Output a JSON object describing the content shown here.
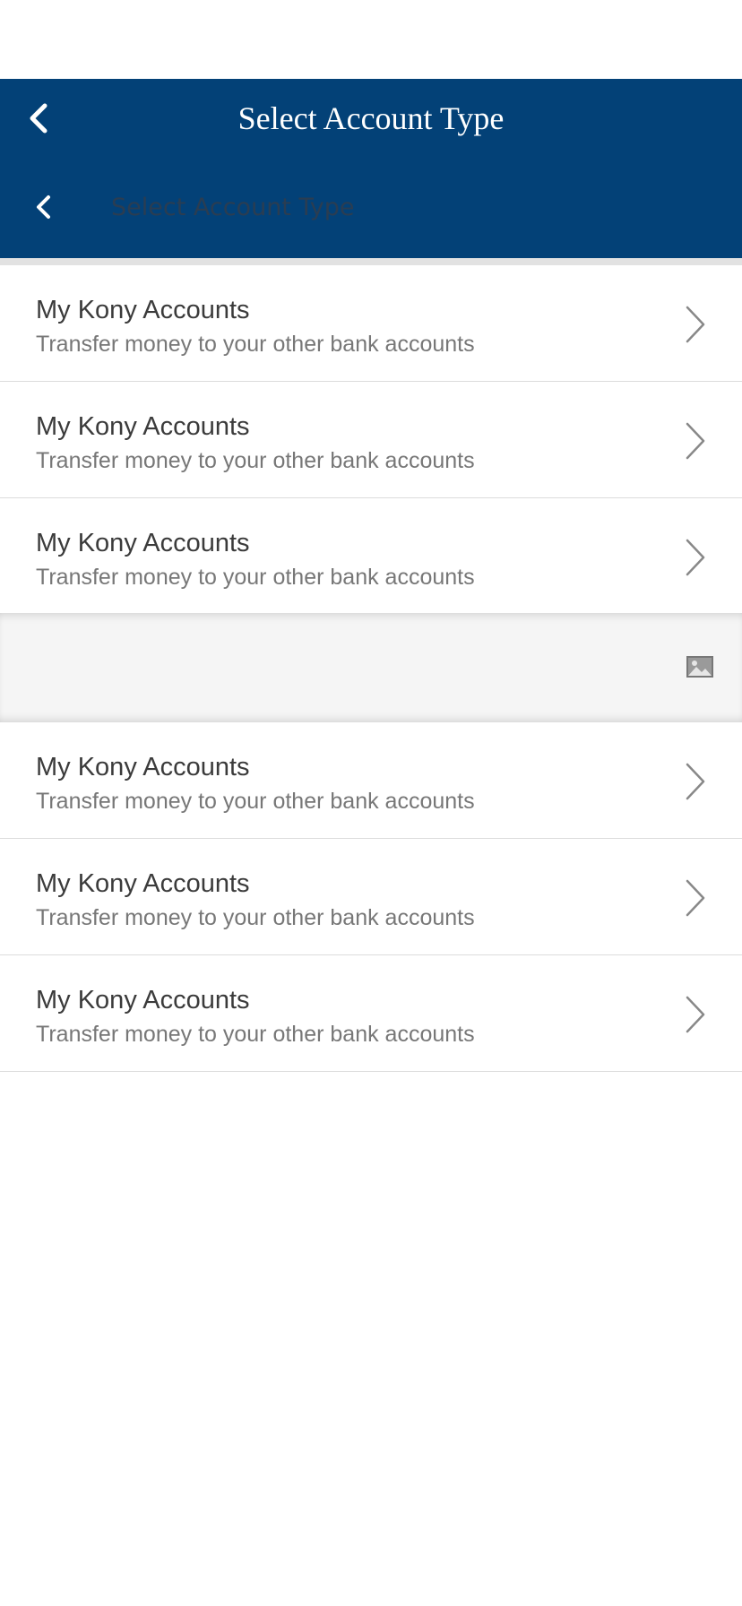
{
  "header": {
    "title": "Select Account Type",
    "subheader_title": "Select Account Type"
  },
  "list_a": [
    {
      "title": "My Kony Accounts",
      "subtitle": "Transfer money to your other bank accounts"
    },
    {
      "title": "My Kony Accounts",
      "subtitle": "Transfer money to your other bank accounts"
    },
    {
      "title": "My Kony Accounts",
      "subtitle": "Transfer money to your other bank accounts"
    }
  ],
  "list_b": [
    {
      "title": "My Kony Accounts",
      "subtitle": "Transfer money to your other bank accounts"
    },
    {
      "title": "My Kony Accounts",
      "subtitle": "Transfer money to your other bank accounts"
    },
    {
      "title": "My Kony Accounts",
      "subtitle": "Transfer money to your other bank accounts"
    }
  ],
  "icons": {
    "back": "chevron-left-icon",
    "row_arrow": "chevron-right-icon",
    "placeholder": "image-icon"
  },
  "colors": {
    "header_bg": "#034177",
    "row_title": "#3b3b3b",
    "row_subtitle": "#777777"
  }
}
